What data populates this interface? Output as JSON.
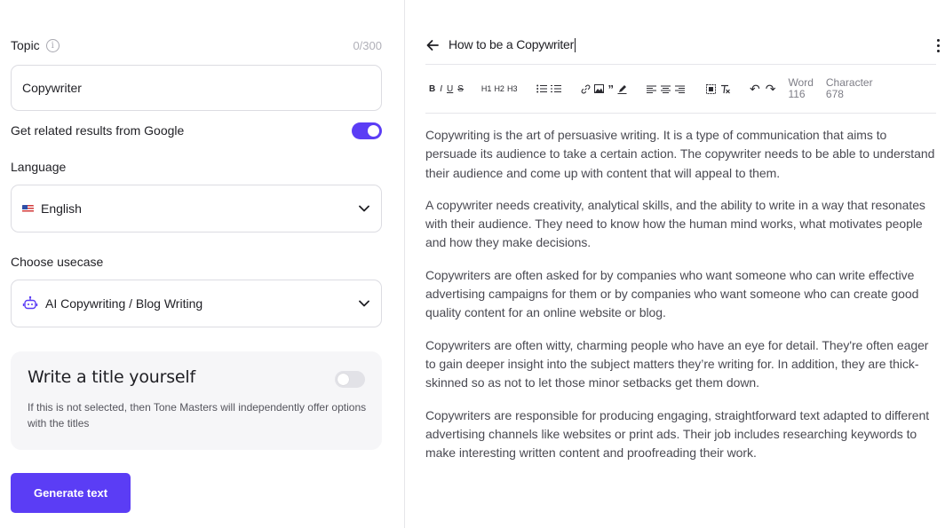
{
  "form": {
    "topic_label": "Topic",
    "topic_counter": "0/300",
    "topic_value": "Copywriter",
    "google_label": "Get related results from Google",
    "google_enabled": true,
    "language_label": "Language",
    "language_value": "English",
    "usecase_label": "Choose usecase",
    "usecase_value": "AI Copywriting / Blog Writing",
    "title_card": {
      "title": "Write a title yourself",
      "enabled": false,
      "description": "If this is not selected, then Tone Masters will independently offer options with the titles"
    },
    "generate_label": "Generate text",
    "accent_color": "#5b3df5"
  },
  "editor": {
    "title": "How to be a Copywriter",
    "toolbar": {
      "bold": "B",
      "italic": "I",
      "underline": "U",
      "strike": "S",
      "h1": "H1",
      "h2": "H2",
      "h3": "H3",
      "undo": "↶",
      "redo": "↷"
    },
    "word_label": "Word",
    "word_count": "116",
    "char_label": "Character",
    "char_count": "678",
    "paragraphs": [
      "Copywriting is the art of persuasive writing. It is a type of communication that aims to persuade its audience to take a certain action. The copywriter needs to be able to understand their audience and come up with content that will appeal to them.",
      "A copywriter needs creativity, analytical skills, and the ability to write in a way that resonates with their audience. They need to know how the human mind works, what motivates people and how they make decisions.",
      "Copywriters are often asked for by companies who want someone who can write effective advertising campaigns for them or by companies who want someone who can create good quality content for an online website or blog.",
      "Copywriters are often witty, charming people who have an eye for detail. They're often eager to gain deeper insight into the subject matters they’re writing for. In addition, they are thick-skinned so as not to let those minor setbacks get them down.",
      "Copywriters are responsible for producing engaging, straightforward text adapted to different advertising channels like websites or print ads. Their job includes researching keywords to make interesting written content and proofreading their work."
    ]
  }
}
